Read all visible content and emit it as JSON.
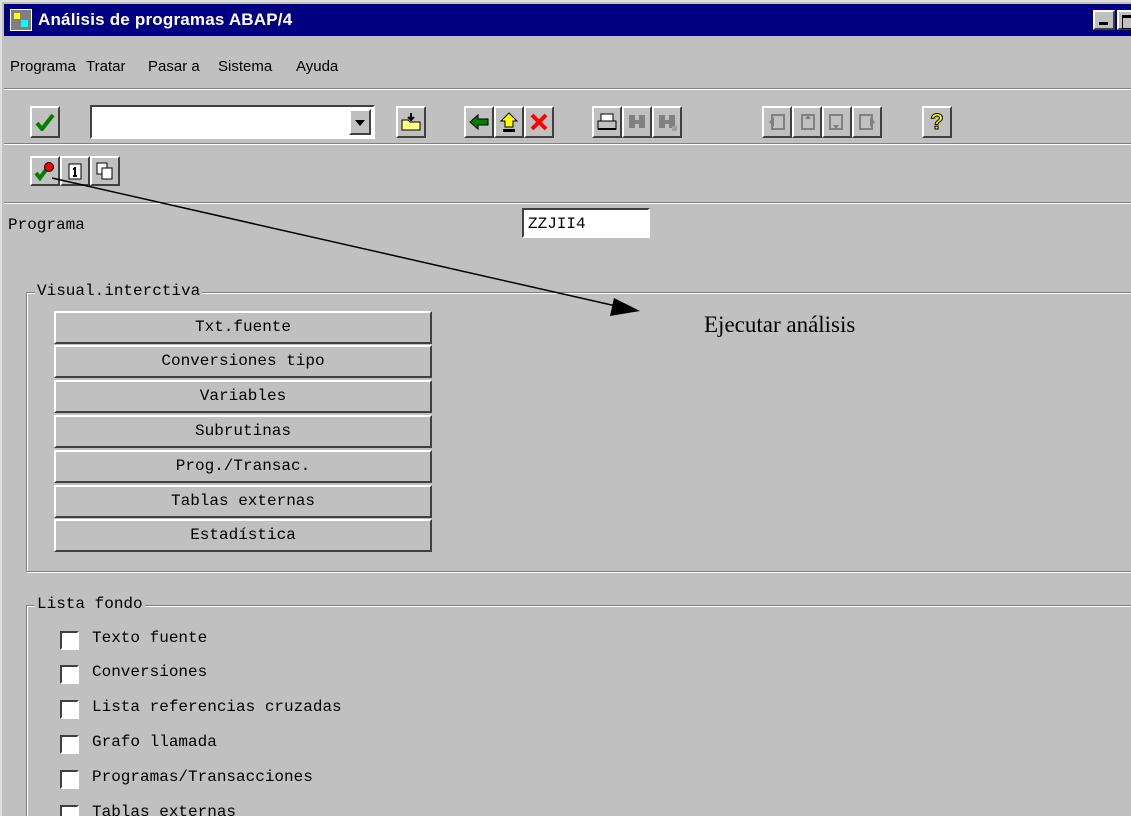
{
  "window": {
    "title": "Análisis de programas ABAP/4"
  },
  "menu": {
    "items": [
      "Programa",
      "Tratar",
      "Pasar a",
      "Sistema",
      "Ayuda"
    ]
  },
  "toolbar": {
    "command_field_value": "",
    "buttons": [
      "check-icon",
      "save-folder-icon",
      "back-arrow-icon",
      "up-exit-icon",
      "cancel-icon",
      "print-icon",
      "find-icon",
      "find-next-icon",
      "first-page-icon",
      "previous-page-icon",
      "next-page-icon",
      "last-page-icon",
      "help-icon"
    ]
  },
  "app_toolbar": {
    "buttons": [
      "execute-icon",
      "info-icon",
      "copy-icon"
    ]
  },
  "form": {
    "program_label": "Programa",
    "program_value": "ZZJII4"
  },
  "visual": {
    "title": "Visual.interctiva",
    "buttons": [
      "Txt.fuente",
      "Conversiones tipo",
      "Variables",
      "Subrutinas",
      "Prog./Transac.",
      "Tablas externas",
      "Estadística"
    ]
  },
  "lista": {
    "title": "Lista fondo",
    "items": [
      "Texto fuente",
      "Conversiones",
      "Lista referencias cruzadas",
      "Grafo llamada",
      "Programas/Transacciones",
      "Tablas externas"
    ]
  },
  "annotation": {
    "text": "Ejecutar análisis"
  },
  "colors": {
    "window_bg": "#c0c0c0",
    "title_bar": "#000080",
    "check_green": "#008000",
    "cancel_red": "#ff0000",
    "help_yellow": "#ffff00"
  }
}
